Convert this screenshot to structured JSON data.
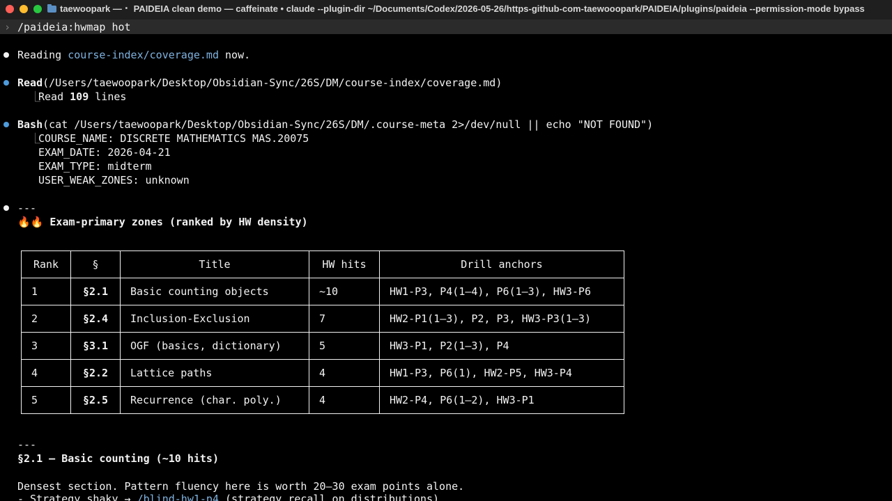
{
  "window": {
    "title": "taewoopark — ⠂ PAIDEIA clean demo — caffeinate • claude --plugin-dir ~/Documents/Codex/2026-05-26/https-github-com-taewooopark/PAIDEIA/plugins/paideia --permission-mode bypass"
  },
  "prompt": {
    "chevron": "›",
    "command": "/paideia:hwmap hot"
  },
  "msg_reading": {
    "prefix": "Reading ",
    "file": "course-index/coverage.md",
    "suffix": " now."
  },
  "read_call": {
    "tool": "Read",
    "args": "(/Users/taewoopark/Desktop/Obsidian-Sync/26S/DM/course-index/coverage.md)",
    "result_prefix": "Read ",
    "result_count": "109",
    "result_suffix": " lines"
  },
  "bash_call": {
    "tool": "Bash",
    "args": "(cat /Users/taewoopark/Desktop/Obsidian-Sync/26S/DM/.course-meta 2>/dev/null || echo \"NOT FOUND\")",
    "output": [
      "COURSE_NAME: DISCRETE MATHEMATICS MAS.20075",
      "EXAM_DATE: 2026-04-21",
      "EXAM_TYPE: midterm",
      "USER_WEAK_ZONES: unknown"
    ]
  },
  "section_rule": "---",
  "heading": {
    "emoji": "🔥🔥",
    "text": "Exam-primary zones (ranked by HW density)"
  },
  "table": {
    "headers": [
      "Rank",
      "§",
      "Title",
      "HW hits",
      "Drill anchors"
    ],
    "rows": [
      [
        "1",
        "§2.1",
        "Basic counting objects",
        "~10",
        "HW1-P3, P4(1–4), P6(1–3), HW3-P6"
      ],
      [
        "2",
        "§2.4",
        "Inclusion-Exclusion",
        "7",
        "HW2-P1(1–3), P2, P3, HW3-P3(1–3)"
      ],
      [
        "3",
        "§3.1",
        "OGF (basics, dictionary)",
        "5",
        "HW3-P1, P2(1–3), P4"
      ],
      [
        "4",
        "§2.2",
        "Lattice paths",
        "4",
        "HW1-P3, P6(1), HW2-P5, HW3-P4"
      ],
      [
        "5",
        "§2.5",
        "Recurrence (char. poly.)",
        "4",
        "HW2-P4, P6(1–2), HW3-P1"
      ]
    ]
  },
  "section2": {
    "rule": "---",
    "heading": "§2.1 — Basic counting (~10 hits)",
    "body": "Densest section. Pattern fluency here is worth 20–30 exam points alone.",
    "bullet_prefix": "- Strategy shaky → ",
    "bullet_link": "/blind-hw1-p4",
    "bullet_suffix": " (strategy recall on distributions)"
  },
  "colors": {
    "background": "#000000",
    "titlebar": "#1f1f1f",
    "prompt_bar": "#2b2b2b",
    "link": "#7fb3e0",
    "tool_bullet": "#4e9bdc"
  }
}
